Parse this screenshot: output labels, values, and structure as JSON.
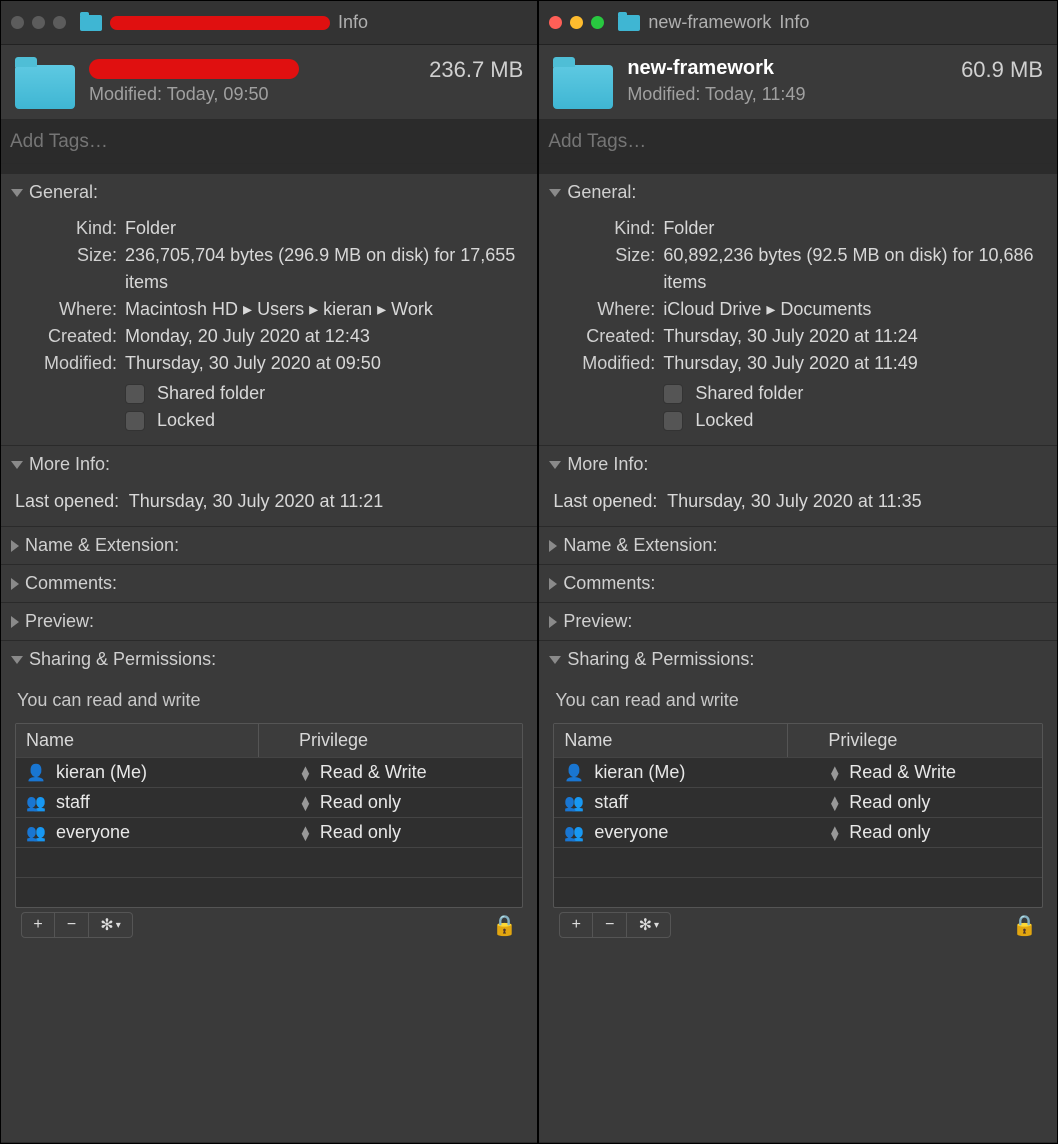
{
  "windows": [
    {
      "title_suffix": "Info",
      "traffic_colors": [
        "#5c5c5c",
        "#5c5c5c",
        "#5c5c5c"
      ],
      "header": {
        "name_redacted": true,
        "name": "",
        "modified_label": "Modified:",
        "modified_value": "Today, 09:50",
        "size": "236.7 MB"
      },
      "tags_placeholder": "Add Tags…",
      "general": {
        "label": "General:",
        "rows": {
          "kind_label": "Kind:",
          "kind_value": "Folder",
          "size_label": "Size:",
          "size_value": "236,705,704 bytes (296.9 MB on disk) for 17,655 items",
          "where_label": "Where:",
          "where_value": "Macintosh HD ▸ Users ▸ kieran ▸ Work",
          "created_label": "Created:",
          "created_value": "Monday, 20 July 2020 at 12:43",
          "modified_label": "Modified:",
          "modified_value": "Thursday, 30 July 2020 at 09:50"
        },
        "shared_label": "Shared folder",
        "locked_label": "Locked"
      },
      "more": {
        "label": "More Info:",
        "last_opened_label": "Last opened:",
        "last_opened_value": "Thursday, 30 July 2020 at 11:21"
      },
      "name_ext_label": "Name & Extension:",
      "comments_label": "Comments:",
      "preview_label": "Preview:",
      "sharing": {
        "label": "Sharing & Permissions:",
        "desc": "You can read and write",
        "th_name": "Name",
        "th_priv": "Privilege",
        "rows": [
          {
            "icon": "single",
            "name": "kieran (Me)",
            "priv": "Read & Write"
          },
          {
            "icon": "group",
            "name": "staff",
            "priv": "Read only"
          },
          {
            "icon": "group",
            "name": "everyone",
            "priv": "Read only"
          }
        ]
      }
    },
    {
      "title_suffix": "Info",
      "title_name": "new-framework",
      "traffic_colors": [
        "#ff5f57",
        "#febc2e",
        "#28c840"
      ],
      "header": {
        "name_redacted": false,
        "name": "new-framework",
        "modified_label": "Modified:",
        "modified_value": "Today, 11:49",
        "size": "60.9 MB"
      },
      "tags_placeholder": "Add Tags…",
      "general": {
        "label": "General:",
        "rows": {
          "kind_label": "Kind:",
          "kind_value": "Folder",
          "size_label": "Size:",
          "size_value": "60,892,236 bytes (92.5 MB on disk) for 10,686 items",
          "where_label": "Where:",
          "where_value": "iCloud Drive ▸ Documents",
          "created_label": "Created:",
          "created_value": "Thursday, 30 July 2020 at 11:24",
          "modified_label": "Modified:",
          "modified_value": "Thursday, 30 July 2020 at 11:49"
        },
        "shared_label": "Shared folder",
        "locked_label": "Locked"
      },
      "more": {
        "label": "More Info:",
        "last_opened_label": "Last opened:",
        "last_opened_value": "Thursday, 30 July 2020 at 11:35"
      },
      "name_ext_label": "Name & Extension:",
      "comments_label": "Comments:",
      "preview_label": "Preview:",
      "sharing": {
        "label": "Sharing & Permissions:",
        "desc": "You can read and write",
        "th_name": "Name",
        "th_priv": "Privilege",
        "rows": [
          {
            "icon": "single",
            "name": "kieran (Me)",
            "priv": "Read & Write"
          },
          {
            "icon": "group",
            "name": "staff",
            "priv": "Read only"
          },
          {
            "icon": "group",
            "name": "everyone",
            "priv": "Read only"
          }
        ]
      }
    }
  ]
}
